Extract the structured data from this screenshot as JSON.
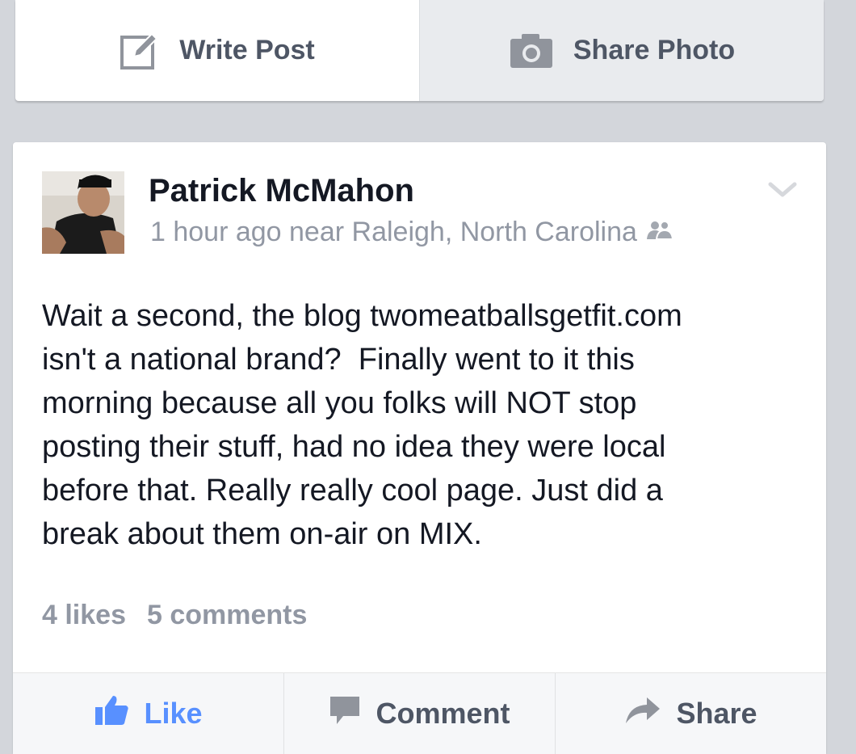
{
  "composer": {
    "write_post_label": "Write Post",
    "share_photo_label": "Share Photo"
  },
  "post": {
    "author": "Patrick McMahon",
    "meta": "1 hour ago near Raleigh, North Carolina",
    "privacy_icon": "friends-icon",
    "text": "Wait a second, the blog twomeatballsgetfit.com\nisn't a national brand?  Finally went to it this\nmorning because all you folks will NOT stop\nposting their stuff, had no idea they were local\nbefore that. Really really cool page. Just did a\nbreak about them on-air on MIX.",
    "likes": "4 likes",
    "comments": "5 comments"
  },
  "actions": {
    "like_label": "Like",
    "comment_label": "Comment",
    "share_label": "Share"
  },
  "colors": {
    "background": "#d3d6db",
    "like_blue": "#5890ff",
    "muted_text": "#9197a3",
    "action_text": "#4e5665"
  }
}
